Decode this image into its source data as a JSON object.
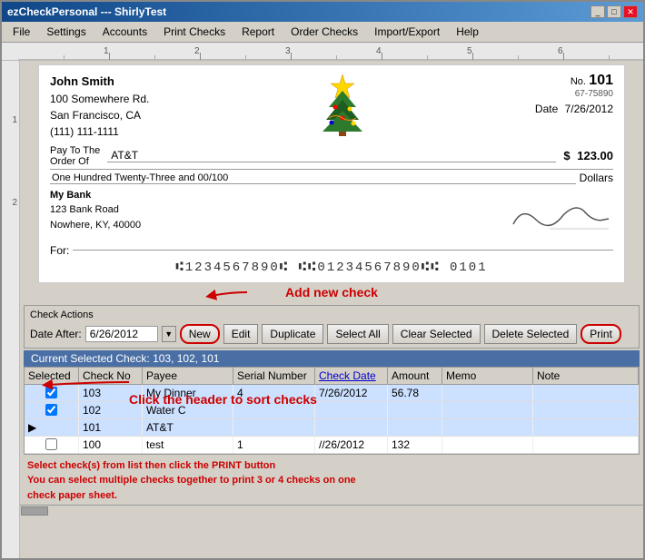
{
  "window": {
    "title": "ezCheckPersonal --- ShirlyTest",
    "controls": [
      "_",
      "□",
      "✕"
    ]
  },
  "menu": {
    "items": [
      "File",
      "Settings",
      "Accounts",
      "Print Checks",
      "Report",
      "Order Checks",
      "Import/Export",
      "Help"
    ]
  },
  "ruler": {
    "marks": [
      "1",
      "2",
      "3",
      "4",
      "5",
      "6"
    ]
  },
  "check": {
    "from_name": "John Smith",
    "from_addr1": "100 Somewhere Rd.",
    "from_addr2": "San Francisco, CA",
    "from_phone": "(111) 111-1111",
    "no_label": "No.",
    "check_number": "101",
    "routing_label": "67-75890",
    "date_label": "Date",
    "date_value": "7/26/2012",
    "pay_to_label": "Pay To The",
    "order_of_label": "Order Of",
    "payee": "AT&T",
    "amount": "123.00",
    "amount_words": "One Hundred Twenty-Three and 00/100",
    "dollars_label": "Dollars",
    "bank_name": "My Bank",
    "bank_addr1": "123 Bank Road",
    "bank_addr2": "Nowhere, KY, 40000",
    "for_label": "For:",
    "signature": "C. Bouge —",
    "micr": "⑆1234567890⑆ ⑆⑆01234567890⑆⑆  0101"
  },
  "annotation": {
    "add_new_check": "Add new check",
    "click_header": "Click the header to sort checks",
    "select_info1": "Select check(s) from list then click the PRINT button",
    "select_info2": "You can select multiple checks together to print 3 or 4 checks on one",
    "select_info3": "check paper sheet."
  },
  "check_actions": {
    "title": "Check Actions",
    "date_label": "Date After:",
    "date_value": "6/26/2012",
    "buttons": {
      "new": "New",
      "edit": "Edit",
      "duplicate": "Duplicate",
      "select_all": "Select All",
      "clear_selected": "Clear Selected",
      "delete_selected": "Delete Selected",
      "print": "Print"
    }
  },
  "current_selected": {
    "label": "Current Selected Check: 103, 102, 101"
  },
  "table": {
    "headers": [
      "Selected",
      "Check No",
      "Payee",
      "Serial Number",
      "Check Date",
      "Amount",
      "Memo",
      "Note"
    ],
    "rows": [
      {
        "selected": true,
        "check_no": "103",
        "payee": "My Dinner",
        "serial": "4",
        "date": "7/26/2012",
        "amount": "56.78",
        "memo": "",
        "note": "",
        "arrow": false
      },
      {
        "selected": true,
        "check_no": "102",
        "payee": "Water C",
        "serial": "",
        "date": "",
        "amount": "",
        "memo": "",
        "note": "",
        "arrow": false
      },
      {
        "selected": true,
        "check_no": "101",
        "payee": "AT&T",
        "serial": "",
        "date": "",
        "amount": "",
        "memo": "",
        "note": "",
        "arrow": true
      },
      {
        "selected": false,
        "check_no": "100",
        "payee": "test",
        "serial": "1",
        "date": "//26/2012",
        "amount": "132",
        "memo": "",
        "note": "",
        "arrow": false
      }
    ]
  }
}
